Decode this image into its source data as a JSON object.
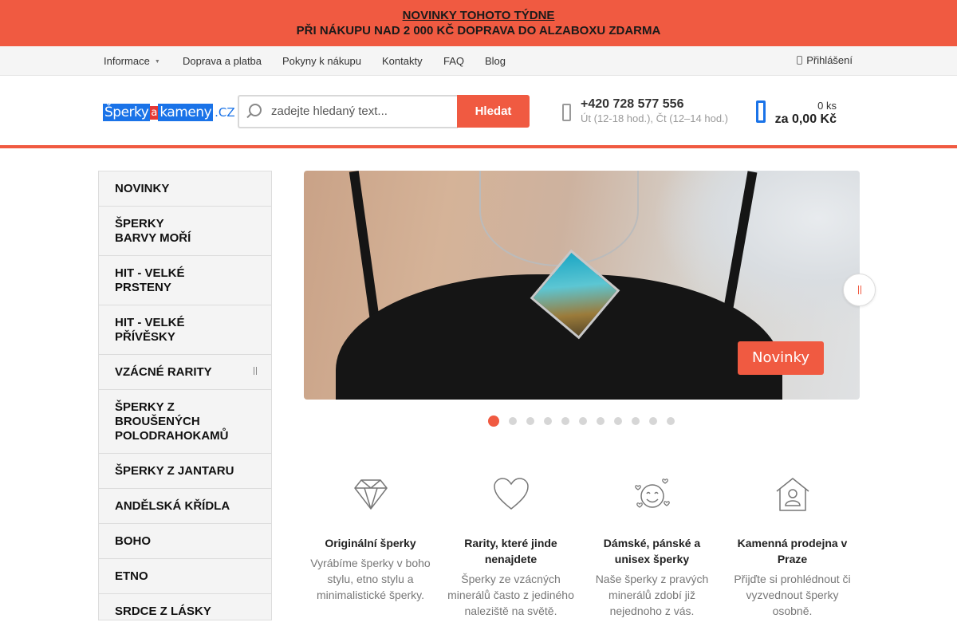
{
  "banner": {
    "line1": "NOVINKY TOHOTO TÝDNE",
    "line2": "PŘI NÁKUPU NAD 2 000 KČ DOPRAVA DO ALZABOXU ZDARMA"
  },
  "top_nav": {
    "items": [
      {
        "label": "Informace",
        "has_dropdown": true
      },
      {
        "label": "Doprava a platba"
      },
      {
        "label": "Pokyny k nákupu"
      },
      {
        "label": "Kontakty"
      },
      {
        "label": "FAQ"
      },
      {
        "label": "Blog"
      }
    ],
    "login_label": "Přihlášení"
  },
  "header": {
    "logo": {
      "part1": "Šperky",
      "part2": "a",
      "part3": "kameny",
      "part4": ".CZ"
    },
    "search": {
      "placeholder": "zadejte hledaný text...",
      "button_label": "Hledat"
    },
    "contact": {
      "phone": "+420 728 577 556",
      "hours": "Út (12-18 hod.), Čt (12–14 hod.)"
    },
    "cart": {
      "count": "0 ks",
      "total": "za 0,00 Kč"
    }
  },
  "sidebar": {
    "items": [
      {
        "label": "NOVINKY"
      },
      {
        "label": "ŠPERKY BARVY MOŘÍ"
      },
      {
        "label": "HIT - VELKÉ PRSTENY"
      },
      {
        "label": "HIT - VELKÉ PŘÍVĚSKY"
      },
      {
        "label": "VZÁCNÉ RARITY",
        "has_submenu": true
      },
      {
        "label": "ŠPERKY Z BROUŠENÝCH POLODRAHOKAMŮ"
      },
      {
        "label": "ŠPERKY Z JANTARU"
      },
      {
        "label": "ANDĚLSKÁ KŘÍDLA"
      },
      {
        "label": "BOHO"
      },
      {
        "label": "ETNO"
      },
      {
        "label": "SRDCE Z LÁSKY"
      }
    ]
  },
  "slider": {
    "cta_label": "Novinky",
    "slide_count": 11,
    "active_index": 0
  },
  "features": [
    {
      "icon": "diamond-icon",
      "title": "Originální šperky",
      "text": "Vyrábíme šperky v boho stylu, etno stylu a minimalistické šperky."
    },
    {
      "icon": "heart-icon",
      "title": "Rarity, které jinde nenajdete",
      "text": "Šperky ze vzácných minerálů často z jediného naleziště na světě."
    },
    {
      "icon": "smiley-hearts-icon",
      "title": "Dámské, pánské a unisex šperky",
      "text": "Naše šperky z pravých minerálů zdobí již nejednoho z vás."
    },
    {
      "icon": "house-person-icon",
      "title": "Kamenná prodejna v Praze",
      "text": "Přijďte si prohlédnout či vyzvednout šperky osobně."
    }
  ],
  "colors": {
    "accent": "#f05a41",
    "brand_blue": "#1a73e8",
    "sidebar_bg": "#f4f4f4"
  }
}
